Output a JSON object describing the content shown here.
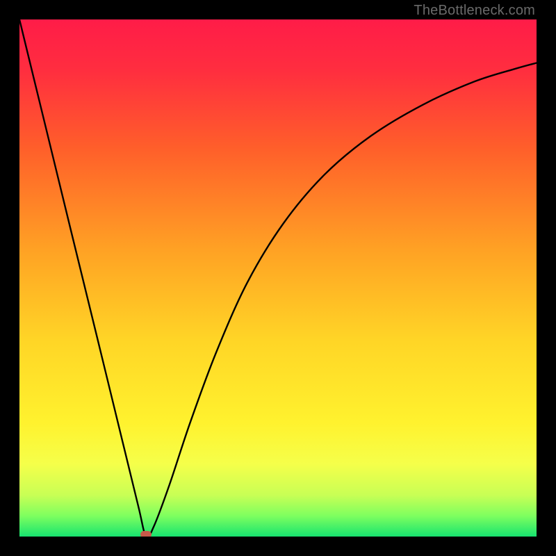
{
  "watermark": "TheBottleneck.com",
  "colors": {
    "marker": "#c85a4a",
    "curve": "#000000"
  },
  "chart_data": {
    "type": "line",
    "title": "",
    "xlabel": "",
    "ylabel": "",
    "xlim": [
      0,
      1
    ],
    "ylim": [
      0,
      1
    ],
    "grid": false,
    "legend": false,
    "notes": "Background is a vertical red→orange→yellow→green gradient (red=high bottleneck, green=low). Black curve shows bottleneck vs an implicit x-axis variable; minimum at x≈0.245 marked by a small red pill. Plot is framed by a thick black border. No numeric axis ticks are rendered.",
    "gradient_stops": [
      {
        "offset": 0.0,
        "color": "#ff1c48"
      },
      {
        "offset": 0.1,
        "color": "#ff2e3f"
      },
      {
        "offset": 0.25,
        "color": "#ff5f2a"
      },
      {
        "offset": 0.45,
        "color": "#ffa324"
      },
      {
        "offset": 0.62,
        "color": "#ffd526"
      },
      {
        "offset": 0.78,
        "color": "#fff22e"
      },
      {
        "offset": 0.86,
        "color": "#f5ff4a"
      },
      {
        "offset": 0.92,
        "color": "#c8ff55"
      },
      {
        "offset": 0.96,
        "color": "#7eff5f"
      },
      {
        "offset": 1.0,
        "color": "#17e36f"
      }
    ],
    "series": [
      {
        "name": "bottleneck-curve",
        "x": [
          0.0,
          0.05,
          0.1,
          0.15,
          0.2,
          0.23,
          0.245,
          0.26,
          0.29,
          0.33,
          0.38,
          0.44,
          0.51,
          0.59,
          0.68,
          0.78,
          0.88,
          0.96,
          1.0
        ],
        "y": [
          1.0,
          0.795,
          0.59,
          0.386,
          0.181,
          0.058,
          0.0,
          0.02,
          0.1,
          0.22,
          0.355,
          0.49,
          0.605,
          0.7,
          0.775,
          0.835,
          0.88,
          0.905,
          0.916
        ]
      }
    ],
    "marker": {
      "x": 0.245,
      "y": 0.0
    }
  }
}
